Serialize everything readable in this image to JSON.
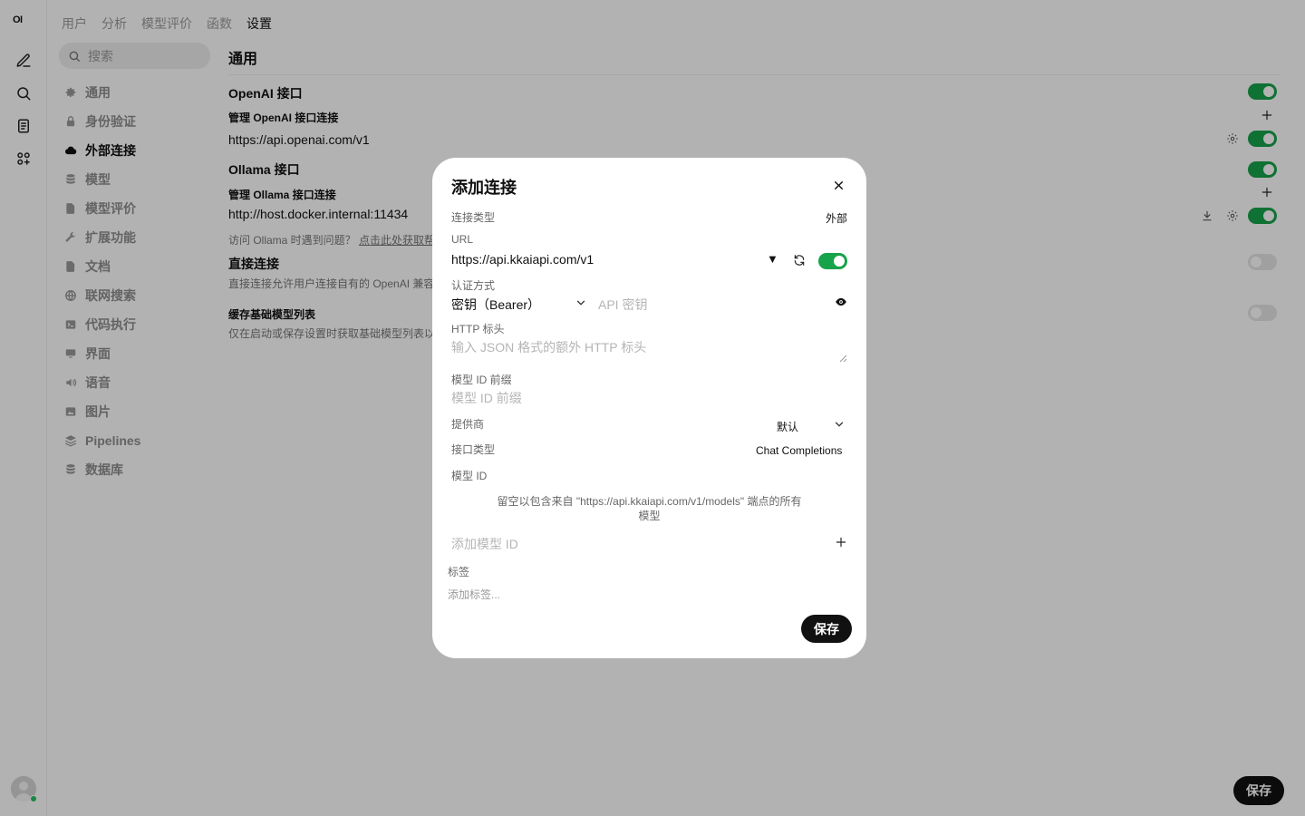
{
  "rail": {
    "logo": "OI",
    "icons": [
      "new-chat-icon",
      "search-icon",
      "notes-icon",
      "workspace-icon",
      "avatar-icon"
    ]
  },
  "topnav": {
    "tabs": [
      "用户",
      "分析",
      "模型评价",
      "函数",
      "设置"
    ],
    "active": "设置"
  },
  "settings": {
    "search_placeholder": "搜索",
    "nav": [
      {
        "label": "通用",
        "icon": "gear-icon"
      },
      {
        "label": "身份验证",
        "icon": "lock-icon"
      },
      {
        "label": "外部连接",
        "icon": "cloud-icon",
        "active": true
      },
      {
        "label": "模型",
        "icon": "database-icon"
      },
      {
        "label": "模型评价",
        "icon": "document-icon"
      },
      {
        "label": "扩展功能",
        "icon": "wrench-icon"
      },
      {
        "label": "文档",
        "icon": "document-icon"
      },
      {
        "label": "联网搜索",
        "icon": "globe-icon"
      },
      {
        "label": "代码执行",
        "icon": "terminal-icon"
      },
      {
        "label": "界面",
        "icon": "monitor-icon"
      },
      {
        "label": "语音",
        "icon": "speaker-icon"
      },
      {
        "label": "图片",
        "icon": "image-icon"
      },
      {
        "label": "Pipelines",
        "icon": "layers-icon"
      },
      {
        "label": "数据库",
        "icon": "database-icon"
      }
    ]
  },
  "content": {
    "title": "通用",
    "openai": {
      "label": "OpenAI 接口",
      "manage_label": "管理 OpenAI 接口连接",
      "url": "https://api.openai.com/v1",
      "enabled": true
    },
    "ollama": {
      "label": "Ollama 接口",
      "manage_label": "管理 Ollama 接口连接",
      "url": "http://host.docker.internal:11434",
      "hint": "访问 Ollama 时遇到问题？",
      "hint_link": "点击此处获取帮助",
      "enabled": true
    },
    "direct": {
      "label": "直接连接",
      "desc": "直接连接允许用户连接自有的 OpenAI 兼容接口。",
      "enabled": false
    },
    "cache": {
      "label": "缓存基础模型列表",
      "desc": "仅在启动或保存设置时获取基础模型列表以提升性能。",
      "enabled": false
    },
    "save_label": "保存"
  },
  "modal": {
    "title": "添加连接",
    "connection_type_label": "连接类型",
    "connection_type_value": "外部",
    "url_label": "URL",
    "url_value": "https://api.kkaiapi.com/v1",
    "url_dropdown_glyph": "▼",
    "url_enabled": true,
    "auth_label": "认证方式",
    "auth_value": "密钥（Bearer）",
    "api_key_placeholder": "API 密钥",
    "headers_label": "HTTP 标头",
    "headers_placeholder": "输入 JSON 格式的额外 HTTP 标头",
    "prefix_label": "模型 ID 前缀",
    "prefix_placeholder": "模型 ID 前缀",
    "provider_label": "提供商",
    "provider_value": "默认",
    "api_type_label": "接口类型",
    "api_type_value": "Chat Completions",
    "model_ids_label": "模型 ID",
    "model_ids_info_line1": "留空以包含来自 \"https://api.kkaiapi.com/v1/models\" 端点的所有",
    "model_ids_info_line2": "模型",
    "add_model_placeholder": "添加模型 ID",
    "tags_label": "标签",
    "tags_placeholder": "添加标签...",
    "save_label": "保存"
  },
  "colors": {
    "accent_green": "#16a34a",
    "overlay": "rgba(0,0,0,0.30)",
    "button_dark": "#111111"
  }
}
